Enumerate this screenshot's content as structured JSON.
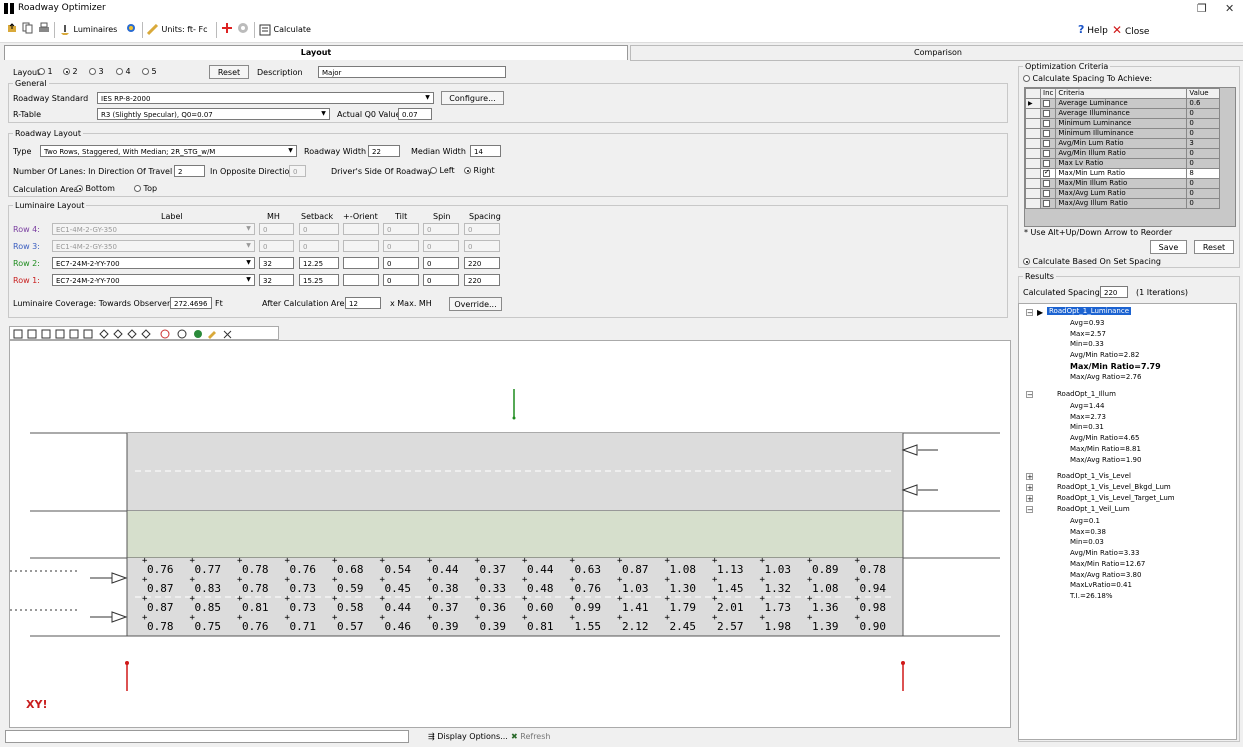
{
  "window": {
    "title": "Roadway Optimizer",
    "restore_glyph": "❐",
    "close_glyph": "✕"
  },
  "toolbar": {
    "luminaires": "Luminaires",
    "units": "Units: ft- Fc",
    "calculate": "Calculate",
    "help": "Help",
    "close": "Close"
  },
  "tabs": {
    "layout": "Layout",
    "comparison": "Comparison"
  },
  "layout_row": {
    "label": "Layout:",
    "options": [
      "1",
      "2",
      "3",
      "4",
      "5"
    ],
    "selected": "2",
    "reset": "Reset",
    "description_label": "Description",
    "description_value": "Major"
  },
  "general": {
    "legend": "General",
    "standard_label": "Roadway Standard",
    "standard_value": "IES RP-8-2000",
    "configure": "Configure...",
    "rtable_label": "R-Table",
    "rtable_value": "R3 (Slightly Specular), Q0=0.07",
    "q0_label": "Actual Q0 Value",
    "q0_value": "0.07"
  },
  "roadway": {
    "legend": "Roadway Layout",
    "type_label": "Type",
    "type_value": "Two Rows, Staggered, With Median; 2R_STG_w/M",
    "width_label": "Roadway Width",
    "width_value": "22",
    "median_label": "Median Width",
    "median_value": "14",
    "lanes_label": "Number Of Lanes:  In Direction Of Travel",
    "lanes_value": "2",
    "opposite_label": "In Opposite Direction",
    "opposite_value": "0",
    "driver_label": "Driver's Side Of Roadway:",
    "left": "Left",
    "right": "Right",
    "calc_label": "Calculation Area:",
    "bottom": "Bottom",
    "top": "Top"
  },
  "luminaire": {
    "legend": "Luminaire Layout",
    "headers": {
      "label": "Label",
      "mh": "MH",
      "setback": "Setback",
      "orient": "+-Orient",
      "tilt": "Tilt",
      "spin": "Spin",
      "spacing": "Spacing"
    },
    "rows": [
      {
        "name": "Row 4:",
        "label": "EC1-4M-2-GY-350",
        "mh": "0",
        "setback": "0",
        "orient": "",
        "tilt": "0",
        "spin": "0",
        "spacing": "0",
        "color": "#7a3ea0"
      },
      {
        "name": "Row 3:",
        "label": "EC1-4M-2-GY-350",
        "mh": "0",
        "setback": "0",
        "orient": "",
        "tilt": "0",
        "spin": "0",
        "spacing": "0",
        "color": "#3a5ec0"
      },
      {
        "name": "Row 2:",
        "label": "EC7-24M-2-YY-700",
        "mh": "32",
        "setback": "12.25",
        "orient": "",
        "tilt": "0",
        "spin": "0",
        "spacing": "220",
        "color": "#1e8c1e"
      },
      {
        "name": "Row 1:",
        "label": "EC7-24M-2-YY-700",
        "mh": "32",
        "setback": "15.25",
        "orient": "",
        "tilt": "0",
        "spin": "0",
        "spacing": "220",
        "color": "#c81e1e"
      }
    ],
    "coverage_label": "Luminaire Coverage:  Towards Observer",
    "coverage_value": "272.4696",
    "coverage_unit": "Ft",
    "after_label": "After Calculation Area",
    "after_value": "12",
    "after_unit": "x Max. MH",
    "override": "Override..."
  },
  "canvas": {
    "xy_label": "XY!",
    "grid_rows": [
      [
        "0.76",
        "0.77",
        "0.78",
        "0.76",
        "0.68",
        "0.54",
        "0.44",
        "0.37",
        "0.44",
        "0.63",
        "0.87",
        "1.08",
        "1.13",
        "1.03",
        "0.89",
        "0.78"
      ],
      [
        "0.87",
        "0.83",
        "0.78",
        "0.73",
        "0.59",
        "0.45",
        "0.38",
        "0.33",
        "0.48",
        "0.76",
        "1.03",
        "1.30",
        "1.45",
        "1.32",
        "1.08",
        "0.94"
      ],
      [
        "0.87",
        "0.85",
        "0.81",
        "0.73",
        "0.58",
        "0.44",
        "0.37",
        "0.36",
        "0.60",
        "0.99",
        "1.41",
        "1.79",
        "2.01",
        "1.73",
        "1.36",
        "0.98"
      ],
      [
        "0.78",
        "0.75",
        "0.76",
        "0.71",
        "0.57",
        "0.46",
        "0.39",
        "0.39",
        "0.81",
        "1.55",
        "2.12",
        "2.45",
        "2.57",
        "1.98",
        "1.39",
        "0.90"
      ]
    ]
  },
  "status": {
    "display_options": "Display Options...",
    "refresh": "Refresh"
  },
  "optimization": {
    "legend": "Optimization Criteria",
    "calc_spacing": "Calculate Spacing To Achieve:",
    "headers": [
      "Inc",
      "Criteria",
      "Value"
    ],
    "criteria": [
      {
        "name": "Average Luminance",
        "value": "0.6",
        "checked": false
      },
      {
        "name": "Average Illuminance",
        "value": "0",
        "checked": false
      },
      {
        "name": "Minimum Luminance",
        "value": "0",
        "checked": false
      },
      {
        "name": "Minimum Illuminance",
        "value": "0",
        "checked": false
      },
      {
        "name": "Avg/Min Lum Ratio",
        "value": "3",
        "checked": false
      },
      {
        "name": "Avg/Min Illum Ratio",
        "value": "0",
        "checked": false
      },
      {
        "name": "Max Lv Ratio",
        "value": "0",
        "checked": false
      },
      {
        "name": "Max/Min Lum Ratio",
        "value": "8",
        "checked": true
      },
      {
        "name": "Max/Min Illum Ratio",
        "value": "0",
        "checked": false
      },
      {
        "name": "Max/Avg Lum Ratio",
        "value": "0",
        "checked": false
      },
      {
        "name": "Max/Avg Illum Ratio",
        "value": "0",
        "checked": false
      }
    ],
    "hint": "* Use Alt+Up/Down Arrow to Reorder",
    "save": "Save",
    "reset": "Reset",
    "calc_set": "Calculate Based On Set Spacing"
  },
  "results": {
    "legend": "Results",
    "spacing_label": "Calculated Spacing",
    "spacing_value": "220",
    "iterations": "(1 Iterations)",
    "tree": {
      "lum": "RoadOpt_1_Luminance",
      "lum_items": [
        "Avg=0.93",
        "Max=2.57",
        "Min=0.33",
        "Avg/Min Ratio=2.82",
        "Max/Min Ratio=7.79",
        "Max/Avg Ratio=2.76"
      ],
      "illum": "RoadOpt_1_Illum",
      "illum_items": [
        "Avg=1.44",
        "Max=2.73",
        "Min=0.31",
        "Avg/Min Ratio=4.65",
        "Max/Min Ratio=8.81",
        "Max/Avg Ratio=1.90"
      ],
      "vis": "RoadOpt_1_Vis_Level",
      "vis_bkgd": "RoadOpt_1_Vis_Level_Bkgd_Lum",
      "vis_target": "RoadOpt_1_Vis_Level_Target_Lum",
      "veil": "RoadOpt_1_Veil_Lum",
      "veil_items": [
        "Avg=0.1",
        "Max=0.38",
        "Min=0.03",
        "Avg/Min Ratio=3.33",
        "Max/Min Ratio=12.67",
        "Max/Avg Ratio=3.80",
        "MaxLvRatio=0.41",
        "T.I.=26.18%"
      ]
    }
  }
}
